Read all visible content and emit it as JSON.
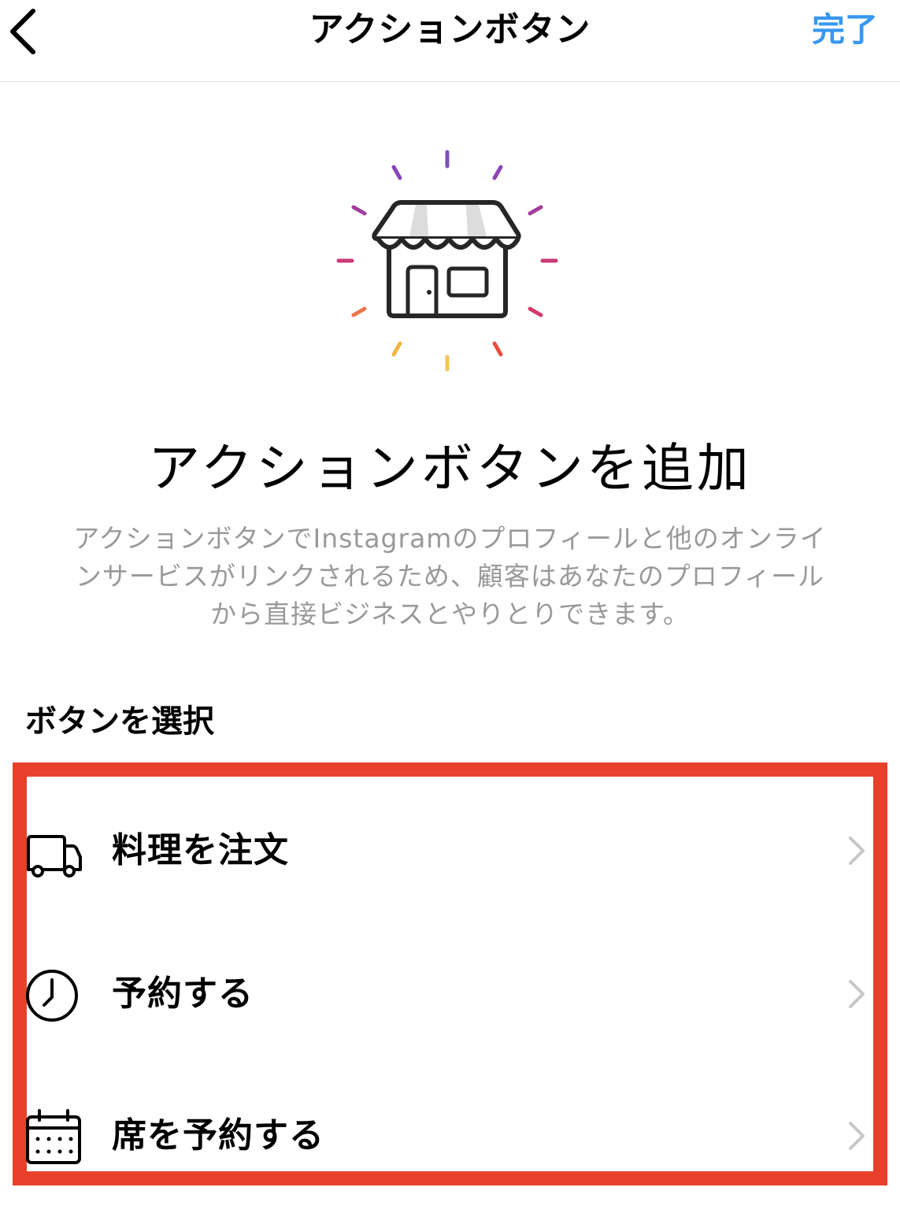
{
  "header": {
    "title": "アクションボタン",
    "done_label": "完了"
  },
  "hero": {
    "icon": "storefront-icon",
    "heading": "アクションボタンを追加",
    "description": "アクションボタンでInstagramのプロフィールと他のオンラインサービスがリンクされるため、顧客はあなたのプロフィールから直接ビジネスとやりとりできます。"
  },
  "section": {
    "label": "ボタンを選択"
  },
  "options": [
    {
      "label": "料理を注文",
      "icon": "delivery-truck-icon"
    },
    {
      "label": "予約する",
      "icon": "clock-icon"
    },
    {
      "label": "席を予約する",
      "icon": "calendar-icon"
    }
  ],
  "colors": {
    "accent": "#3897f0",
    "highlight": "#e8412b",
    "secondary_text": "#999999"
  }
}
